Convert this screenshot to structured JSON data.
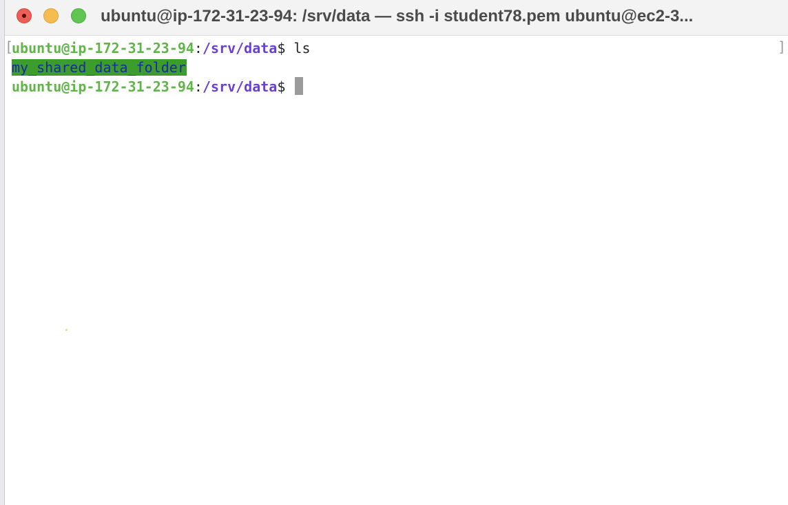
{
  "window": {
    "title": "ubuntu@ip-172-31-23-94: /srv/data — ssh -i student78.pem ubuntu@ec2-3..."
  },
  "terminal": {
    "line1": {
      "user_host": "ubuntu@ip-172-31-23-94",
      "colon": ":",
      "path": "/srv/data",
      "prompt_symbol": "$",
      "command": " ls"
    },
    "line2": {
      "entry": "my_shared_data_folder"
    },
    "line3": {
      "user_host": "ubuntu@ip-172-31-23-94",
      "colon": ":",
      "path": "/srv/data",
      "prompt_symbol": "$",
      "command": " "
    },
    "brackets": {
      "left": "[",
      "right": "]"
    }
  },
  "colors": {
    "user_host": "#5fb547",
    "path": "#6a3fd6",
    "dir_bg": "#3d9d2c",
    "dir_fg": "#1a2aa0",
    "close": "#ec5f57",
    "minimize": "#f5bd4f",
    "zoom": "#61c554"
  },
  "icons": {
    "close": "close-icon",
    "minimize": "minimize-icon",
    "zoom": "zoom-icon"
  }
}
